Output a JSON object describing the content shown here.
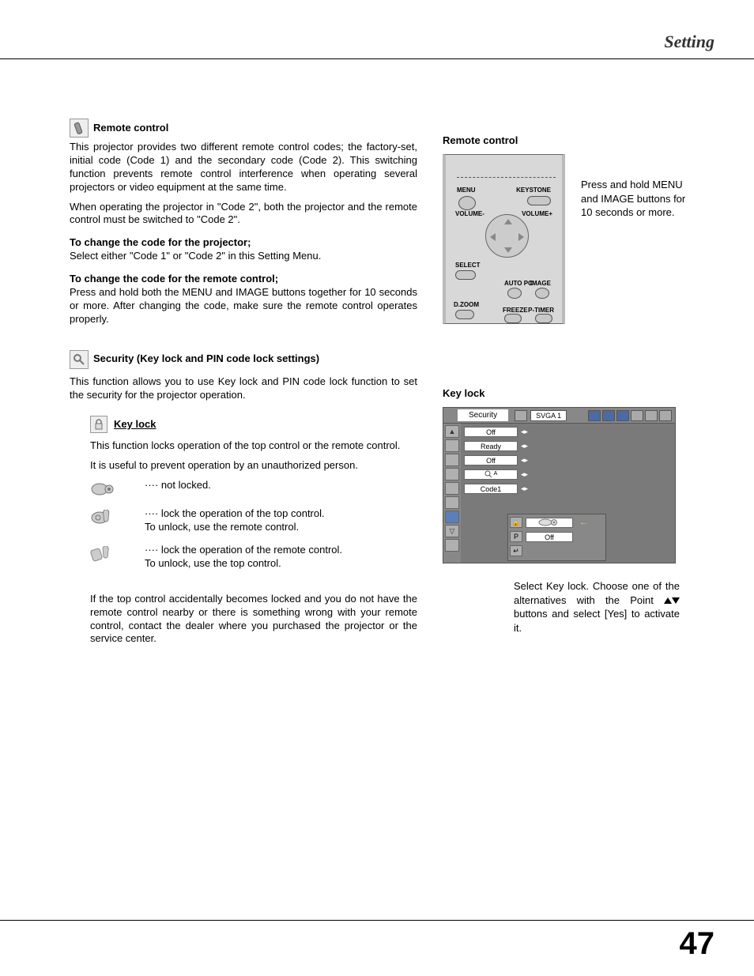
{
  "page": {
    "header": "Setting",
    "number": "47"
  },
  "left": {
    "remote_heading": "Remote control",
    "remote_p1": "This projector provides two different remote control codes; the factory-set, initial code (Code 1) and the secondary code (Code 2).  This switching function prevents remote control interference when operating several projectors or video equipment at the same time.",
    "remote_p2": "When operating the projector in \"Code 2\",  both the projector and the remote control must be switched to \"Code 2\".",
    "change_proj_heading": "To change the code for the projector;",
    "change_proj_text": "Select either \"Code 1\" or \"Code 2\" in this Setting Menu.",
    "change_rc_heading": "To change the code for the remote control;",
    "change_rc_text": "Press and hold both the MENU and IMAGE buttons together for 10 seconds or more.  After changing the code, make sure the  remote control operates properly.",
    "security_heading": "Security (Key lock and PIN code lock settings)",
    "security_text": "This function allows you to use Key lock and PIN code lock function to set the security for the projector operation.",
    "keylock_heading": "Key lock",
    "keylock_p1": "This function locks operation of the top control or the remote control.",
    "keylock_p2": "It is useful to prevent operation by an unauthorized person.",
    "lock_items": [
      "···· not locked.",
      "···· lock the operation of the top control.",
      "To unlock, use the remote control.",
      "···· lock the operation of the remote control.",
      "To unlock, use the top control."
    ],
    "keylock_footer": "If the top control accidentally becomes locked and you do not have the remote control nearby or there is something wrong with your remote control, contact the dealer where you purchased the projector or the service center."
  },
  "right": {
    "remote_heading": "Remote control",
    "remote_caption": "Press and hold MENU and IMAGE buttons for 10 seconds or more.",
    "remote_labels": {
      "menu": "MENU",
      "keystone": "KEYSTONE",
      "vol_minus": "VOLUME-",
      "vol_plus": "VOLUME+",
      "select": "SELECT",
      "autopc": "AUTO PC",
      "image": "IMAGE",
      "dzoom": "D.ZOOM",
      "freeze": "FREEZE",
      "ptimer": "P-TIMER"
    },
    "keylock_heading": "Key lock",
    "menu": {
      "title": "Security",
      "svga": "SVGA 1",
      "rows": [
        "Off",
        "Ready",
        "Off",
        "",
        "Code1"
      ],
      "row4_icon_label": "A",
      "submenu": {
        "row1_val_icon": "proj",
        "row2_val": "Off"
      }
    },
    "menu_caption_pre": "Select Key lock.  Choose one of the alternatives with the Point ",
    "menu_caption_post": " buttons and select [Yes] to activate it."
  }
}
